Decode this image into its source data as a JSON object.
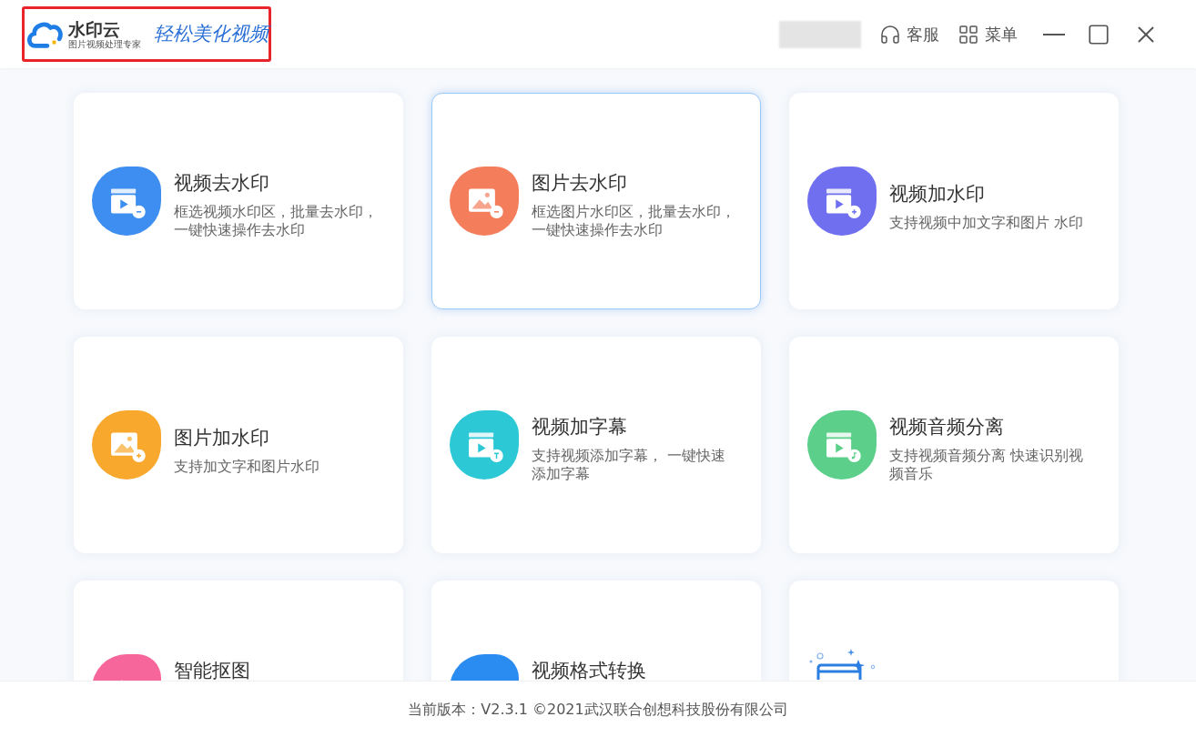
{
  "header": {
    "logo_name": "水印云",
    "logo_tagline": "图片视频处理专家",
    "slogan": "轻松美化视频",
    "actions": [
      {
        "kind": "support",
        "label": "客服"
      },
      {
        "kind": "menu",
        "label": "菜单"
      }
    ]
  },
  "cards": [
    {
      "kind": "videoremove",
      "title": "视频去水印",
      "description": "框选视频水印区，批量去水印，一键快速操作去水印",
      "color": "#3d8ef0",
      "selected": false
    },
    {
      "kind": "imageremove",
      "title": "图片去水印",
      "description": "框选图片水印区，批量去水印，一键快速操作去水印",
      "color": "#f47e5c",
      "selected": true
    },
    {
      "kind": "videoadd",
      "title": "视频加水印",
      "description": "支持视频中加文字和图片 水印",
      "color": "#6f6ff0",
      "selected": false
    },
    {
      "kind": "imageadd",
      "title": "图片加水印",
      "description": "支持加文字和图片水印",
      "color": "#f8a82c",
      "selected": false
    },
    {
      "kind": "subtitle",
      "title": "视频加字幕",
      "description": "支持视频添加字幕， 一键快速添加字幕",
      "color": "#2cc8d6",
      "selected": false
    },
    {
      "kind": "audio",
      "title": "视频音频分离",
      "description": "支持视频音频分离 快速识别视频音乐",
      "color": "#5ccf8a",
      "selected": false
    },
    {
      "kind": "cutout",
      "title": "智能抠图",
      "color": "#f7669a",
      "selected": false
    },
    {
      "kind": "convert",
      "title": "视频格式转换",
      "color": "#2a8cf0",
      "selected": false
    },
    {
      "kind": "coming",
      "selected": false
    }
  ],
  "footer": {
    "text": "当前版本：V2.3.1 ©2021武汉联合创想科技股份有限公司"
  }
}
